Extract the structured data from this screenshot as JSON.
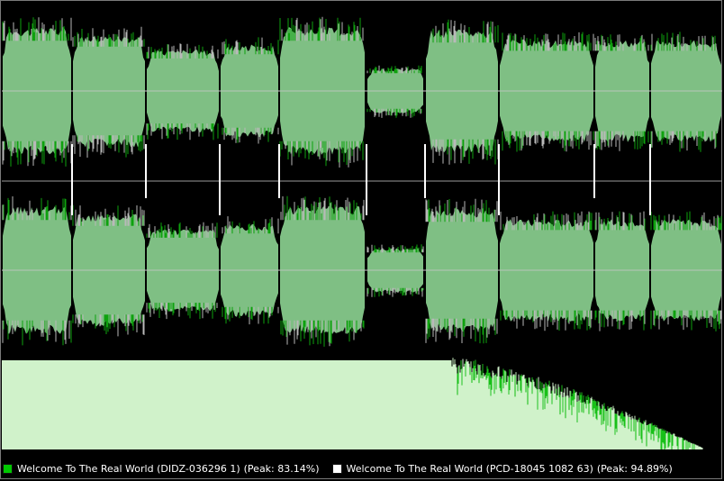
{
  "colors": {
    "background": "#000000",
    "wave_fill": "#7fbf84",
    "wave_hi": "#0ea20e",
    "wave_lo": "#b9b9b9",
    "center_line": "#c8c8c8",
    "marker": "#ffffff",
    "spectrum_light": "#d8f5d3",
    "spectrum_green": "#18c018"
  },
  "segments": [
    {
      "amp": 0.85
    },
    {
      "amp": 0.75
    },
    {
      "amp": 0.55
    },
    {
      "amp": 0.62
    },
    {
      "amp": 0.85
    },
    {
      "amp": 0.3
    },
    {
      "amp": 0.82
    },
    {
      "amp": 0.68
    },
    {
      "amp": 0.68
    },
    {
      "amp": 0.68
    }
  ],
  "legend": [
    {
      "label": "Welcome To The Real World (DIDZ-036296 1)",
      "peak": "(Peak: 83.14%)",
      "color": "#00c800"
    },
    {
      "label": "Welcome To The Real World (PCD-18045 1082 63)",
      "peak": "(Peak: 94.89%)",
      "color": "#ffffff"
    }
  ]
}
